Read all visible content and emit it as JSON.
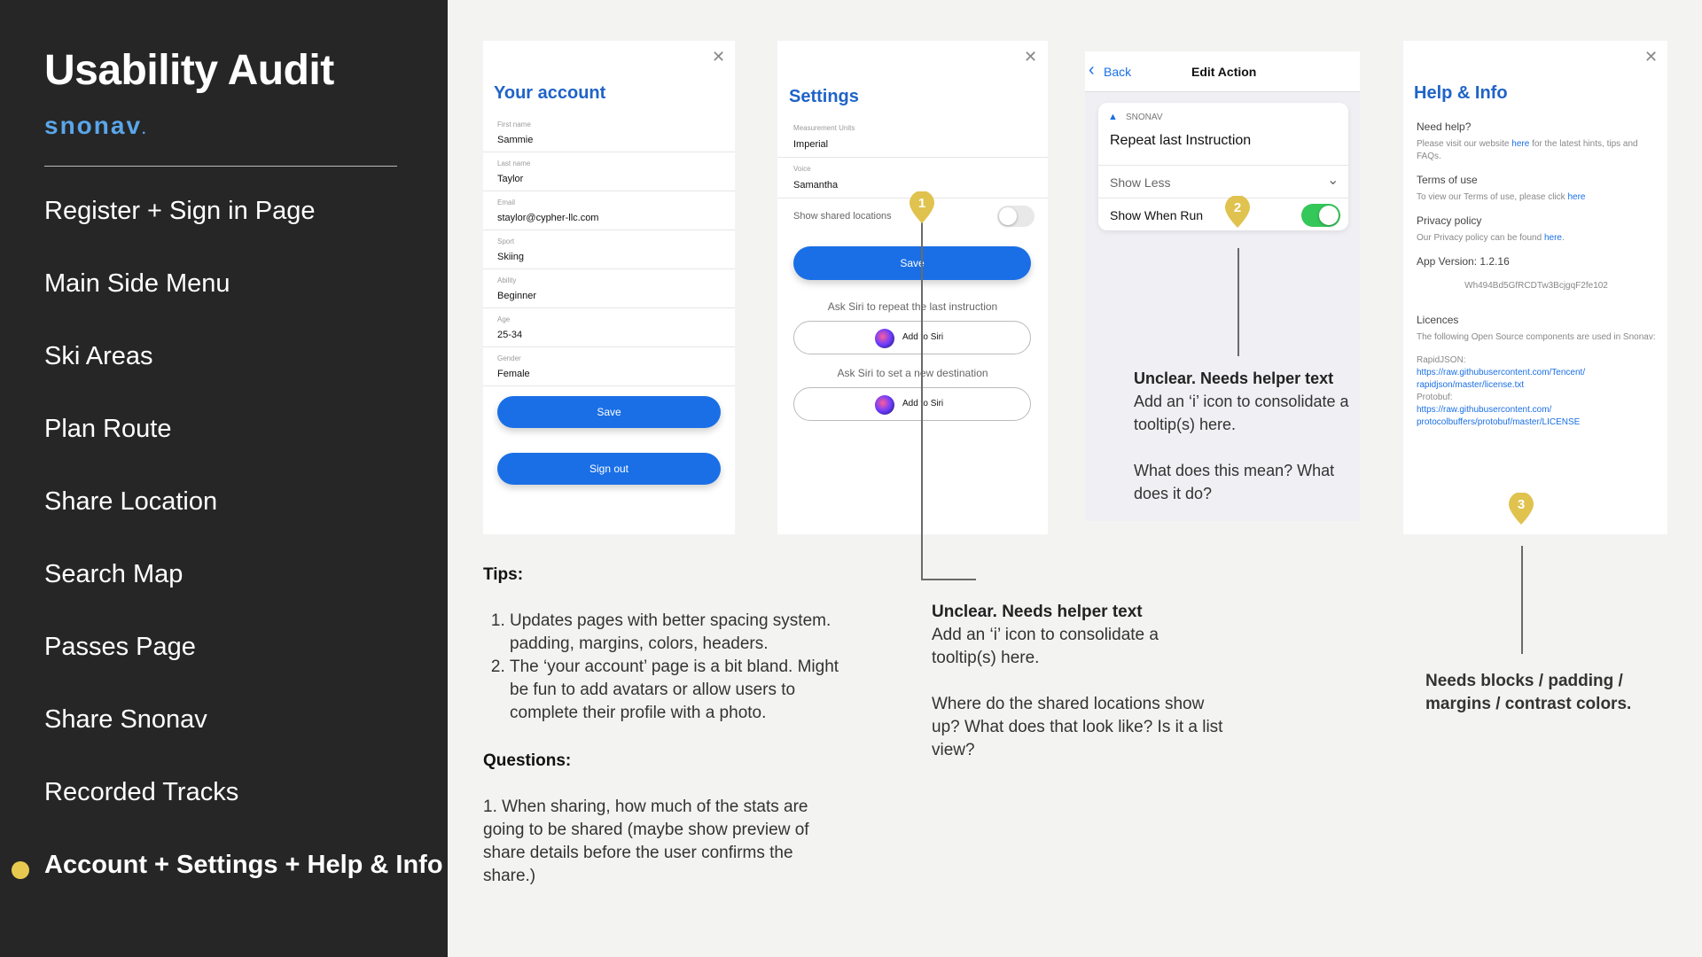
{
  "sidebar": {
    "title": "Usability Audit",
    "logo": "snonav",
    "nav": [
      {
        "label": "Register + Sign in Page"
      },
      {
        "label": "Main Side Menu"
      },
      {
        "label": "Ski Areas"
      },
      {
        "label": "Plan Route"
      },
      {
        "label": "Share Location"
      },
      {
        "label": "Search Map"
      },
      {
        "label": "Passes Page"
      },
      {
        "label": "Share Snonav"
      },
      {
        "label": "Recorded Tracks"
      },
      {
        "label": "Account + Settings + Help & Info"
      }
    ],
    "active_index": 9,
    "active_color": "#e8c94f"
  },
  "account": {
    "title": "Your account",
    "fields": [
      {
        "label": "First name",
        "value": "Sammie"
      },
      {
        "label": "Last name",
        "value": "Taylor"
      },
      {
        "label": "Email",
        "value": "staylor@cypher-llc.com"
      },
      {
        "label": "Sport",
        "value": "Skiing"
      },
      {
        "label": "Ability",
        "value": "Beginner"
      },
      {
        "label": "Age",
        "value": "25-34"
      },
      {
        "label": "Gender",
        "value": "Female"
      }
    ],
    "save_label": "Save",
    "signout_label": "Sign out"
  },
  "settings": {
    "title": "Settings",
    "units_label": "Measurement Units",
    "units_value": "Imperial",
    "voice_label": "Voice",
    "voice_value": "Samantha",
    "shared_label": "Show shared locations",
    "save_label": "Save",
    "siri_caption_1": "Ask Siri to repeat the last instruction",
    "siri_caption_2": "Ask Siri to set a new destination",
    "siri_btn_label": "Add to Siri"
  },
  "edit_action": {
    "back_label": "Back",
    "title": "Edit Action",
    "app_name": "SNONAV",
    "instruction": "Repeat last Instruction",
    "show_less": "Show Less",
    "show_when_run": "Show When Run",
    "toggle_on": true
  },
  "help": {
    "title": "Help & Info",
    "need_help_head": "Need help?",
    "need_help_text_a": "Please visit our website ",
    "need_help_link": "here",
    "need_help_text_b": " for the latest hints, tips and FAQs.",
    "terms_head": "Terms of use",
    "terms_text": "To view our Terms of use, please click ",
    "terms_link": "here",
    "privacy_head": "Privacy policy",
    "privacy_text": "Our Privacy policy can be found ",
    "privacy_link": "here",
    "version_head": "App Version: 1.2.16",
    "version_id": "Wh494Bd5GfRCDTw3BcjgqF2fe102",
    "licences_head": "Licences",
    "licences_text": "The following Open Source components are used in Snonav:",
    "rapidjson_label": "RapidJSON:",
    "rapidjson_url_1": "https://raw.githubusercontent.com/Tencent/",
    "rapidjson_url_2": "rapidjson/master/license.txt",
    "protobuf_label": "Protobuf:",
    "protobuf_url_1": "https://raw.githubusercontent.com/",
    "protobuf_url_2": "protocolbuffers/protobuf/master/LICENSE"
  },
  "markers": [
    "1",
    "2",
    "3"
  ],
  "marker_color": "#e0c24f",
  "notes": {
    "tips_head": "Tips:",
    "tips": [
      "Updates pages with better spacing system. padding, margins, colors, headers.",
      "The ‘your account’ page is a bit bland. Might be fun to add avatars or allow users to complete their profile with a photo."
    ],
    "questions_head": "Questions:",
    "questions_text": " 1. When sharing, how much of the stats are going to be shared (maybe show preview of share details before the user confirms the share.)",
    "note1_head": "Unclear. Needs helper text",
    "note1_body": "Add an ‘i’ icon to consolidate a tooltip(s) here.",
    "note1_question": "Where do the shared locations show up? What does that look like? Is it a list view?",
    "note2_head": "Unclear. Needs helper text",
    "note2_body": "Add an ‘i’ icon to consolidate a tooltip(s) here.",
    "note2_question": "What does this mean? What does it do?",
    "note3": "Needs blocks / padding / margins / contrast colors."
  }
}
